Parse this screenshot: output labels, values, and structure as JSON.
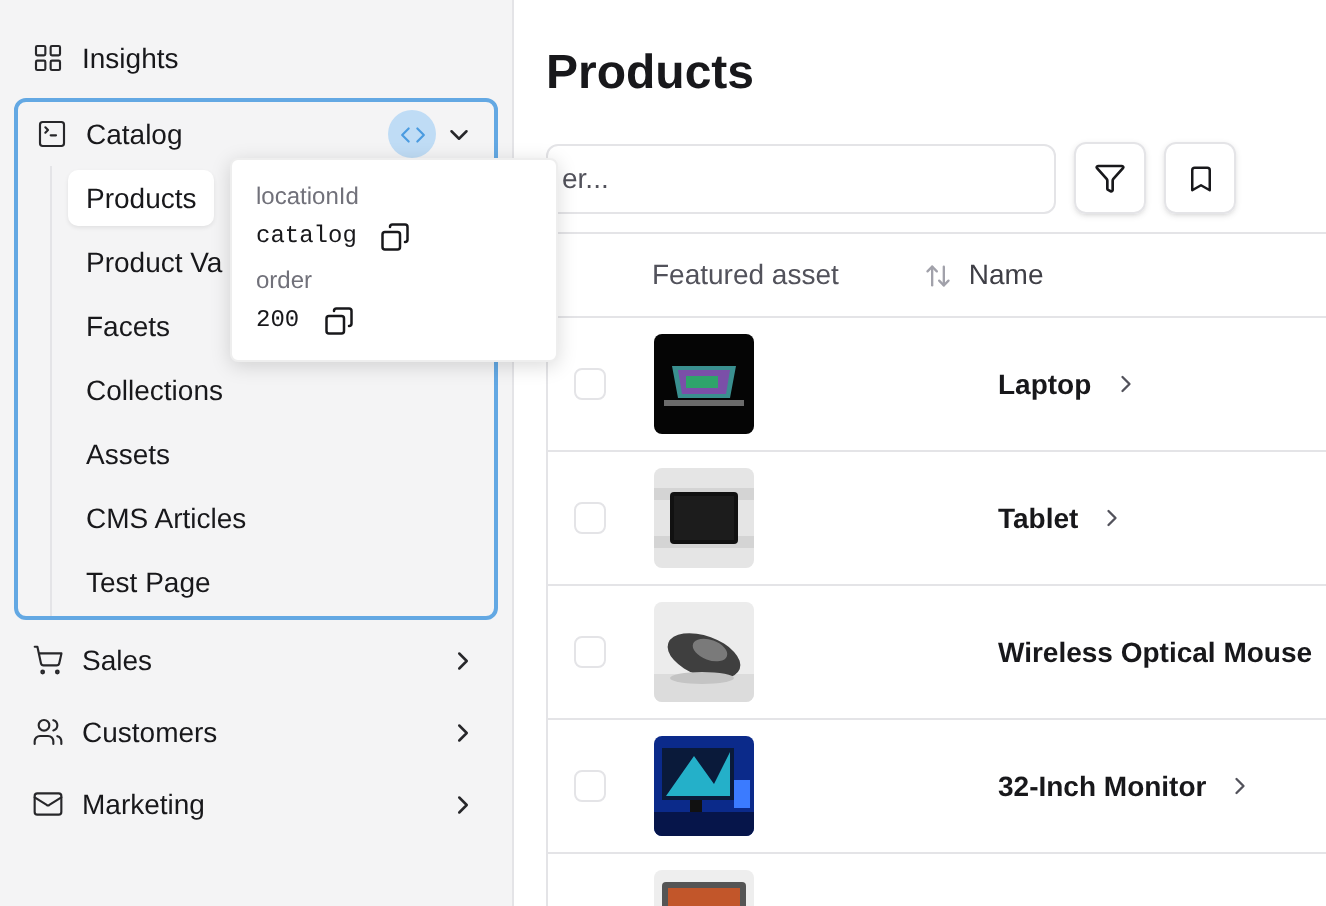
{
  "sidebar": {
    "items": [
      {
        "label": "Insights",
        "kind": "link"
      },
      {
        "label": "Catalog",
        "kind": "group",
        "expanded": true,
        "outlined": true,
        "children": [
          {
            "label": "Products",
            "selected": true
          },
          {
            "label": "Product Va",
            "selected": false
          },
          {
            "label": "Facets",
            "selected": false
          },
          {
            "label": "Collections",
            "selected": false
          },
          {
            "label": "Assets",
            "selected": false
          },
          {
            "label": "CMS Articles",
            "selected": false
          },
          {
            "label": "Test Page",
            "selected": false
          }
        ]
      },
      {
        "label": "Sales",
        "kind": "group",
        "expanded": false,
        "outlined": false
      },
      {
        "label": "Customers",
        "kind": "group",
        "expanded": false,
        "outlined": false
      },
      {
        "label": "Marketing",
        "kind": "group",
        "expanded": false,
        "outlined": false
      }
    ]
  },
  "popover": {
    "fields": [
      {
        "label": "locationId",
        "value": "catalog"
      },
      {
        "label": "order",
        "value": "200"
      }
    ]
  },
  "page": {
    "title": "Products",
    "search": {
      "placeholder": "er..."
    }
  },
  "table": {
    "columns": [
      "Featured asset",
      "Name"
    ],
    "rows": [
      {
        "checked": false,
        "image": {
          "kind": "picture"
        },
        "name": "Laptop",
        "expandable": true
      },
      {
        "checked": false,
        "image": {
          "kind": "picture"
        },
        "name": "Tablet",
        "expandable": true
      },
      {
        "checked": false,
        "image": {
          "kind": "picture"
        },
        "name": "Wireless Optical Mouse"
      },
      {
        "checked": false,
        "image": {
          "kind": "picture"
        },
        "name": "32-Inch Monitor",
        "expandable": true
      },
      {
        "image": {
          "kind": "picture"
        }
      }
    ]
  }
}
